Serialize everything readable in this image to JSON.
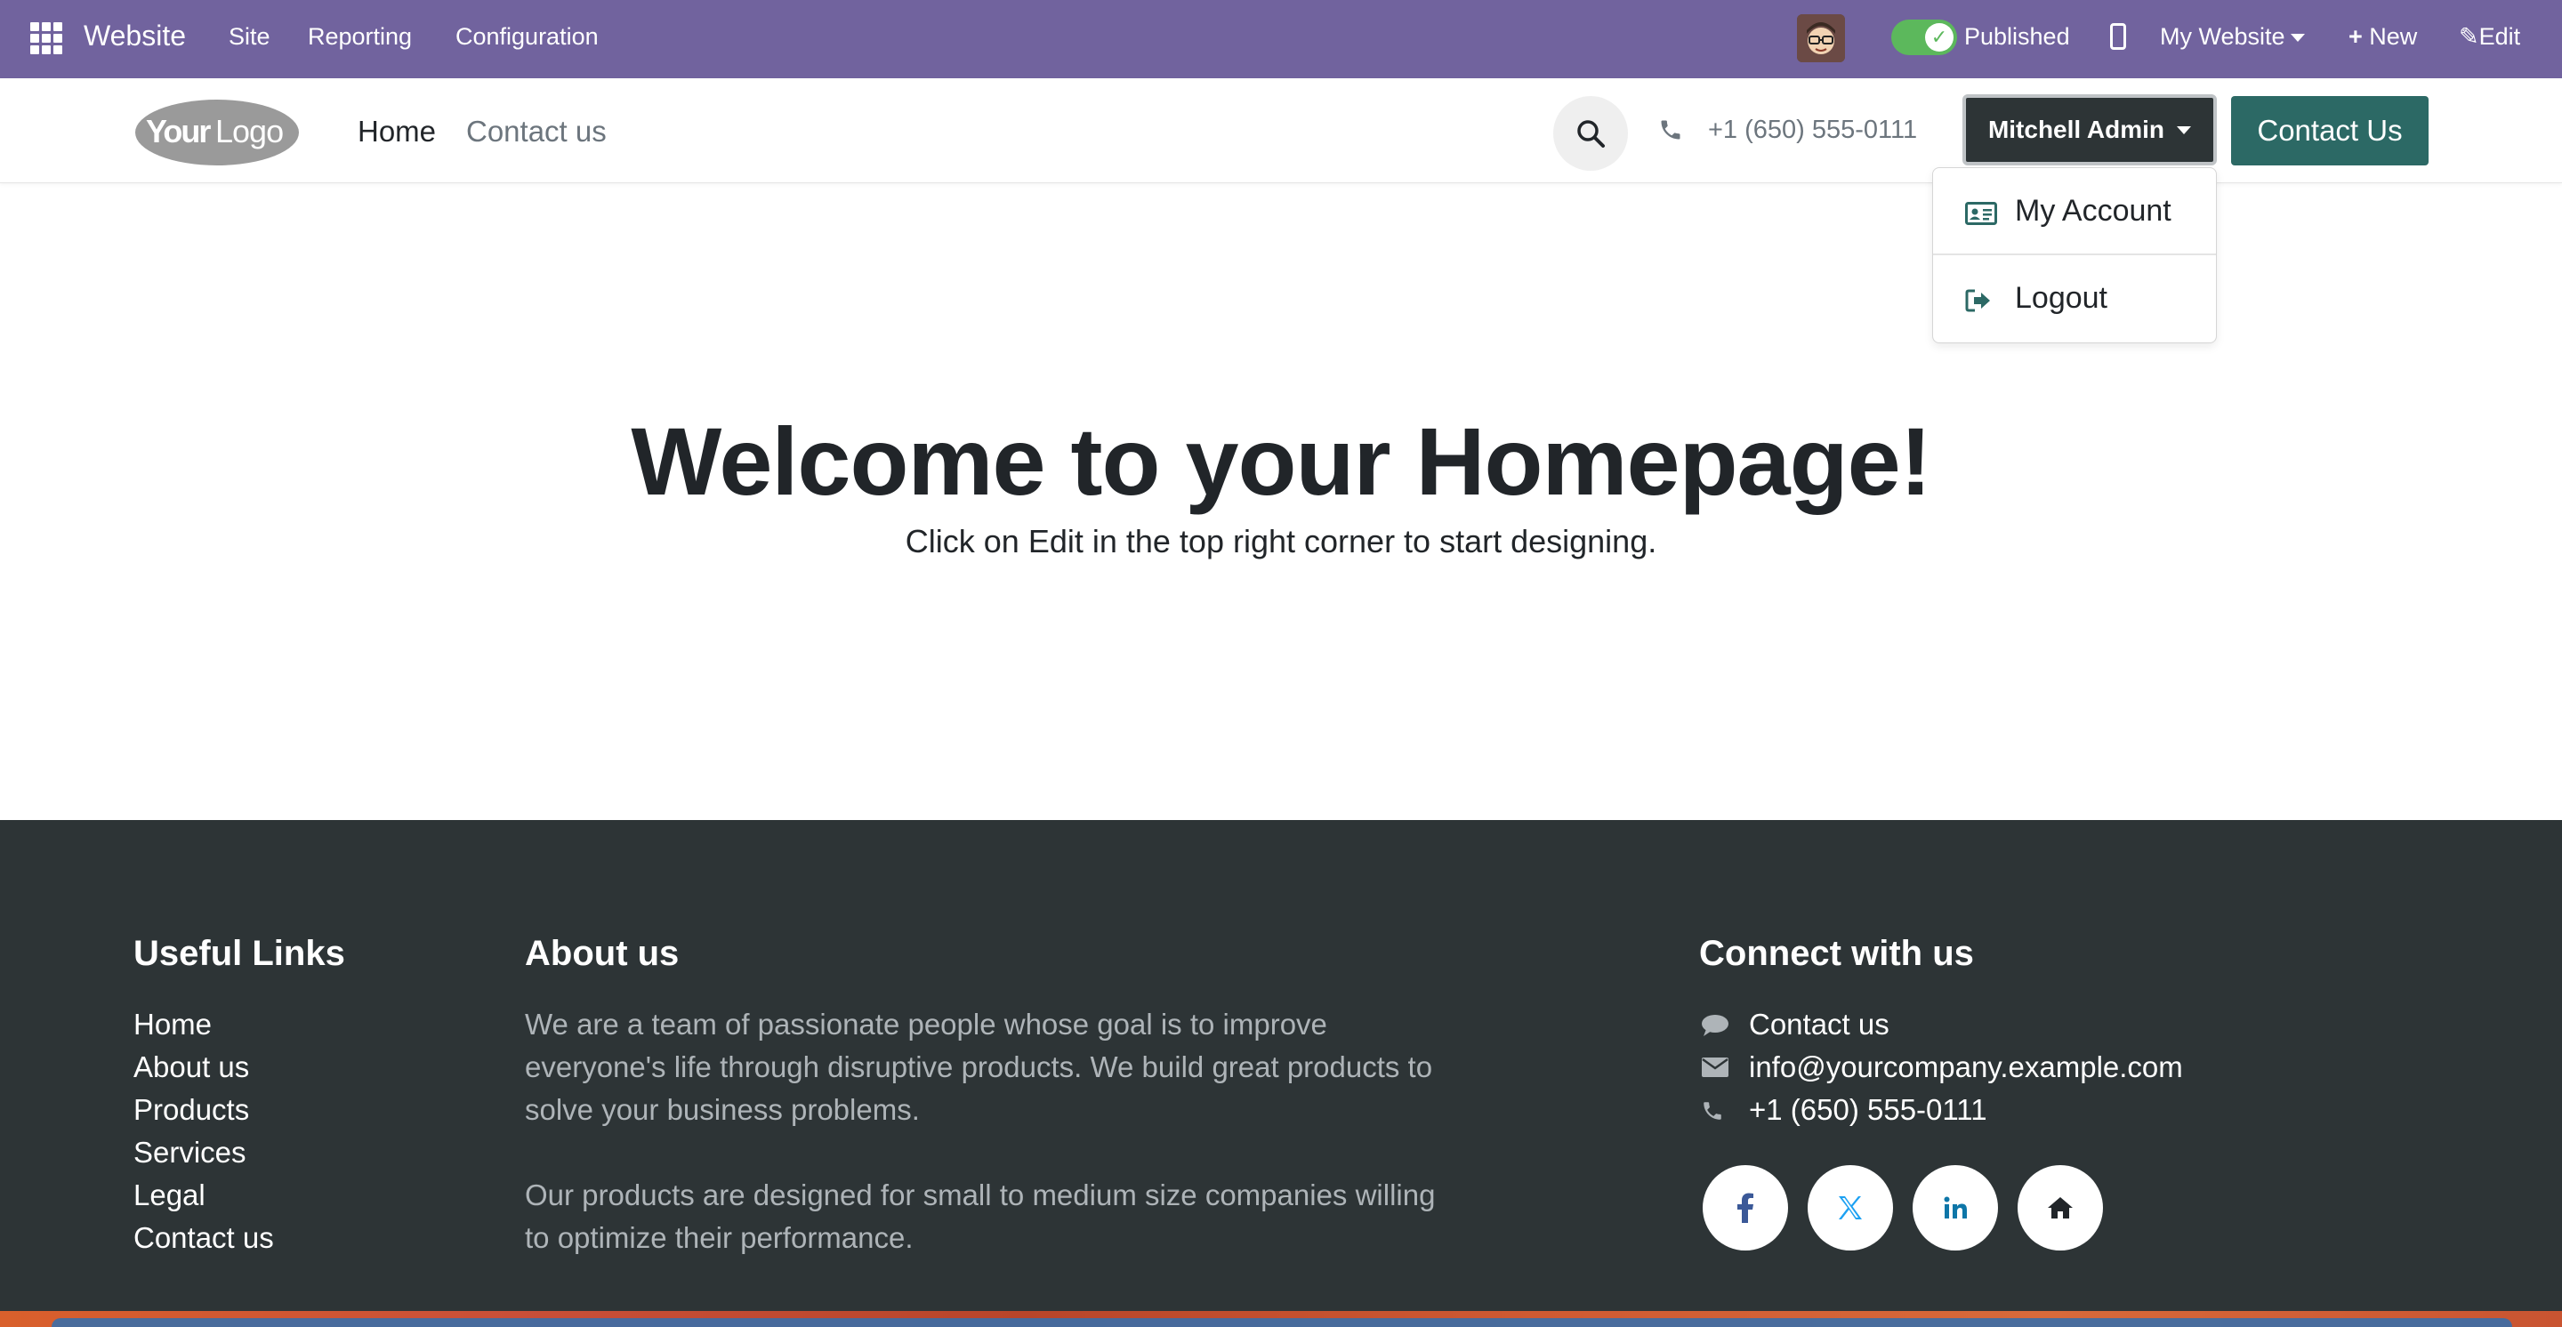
{
  "admin_bar": {
    "brand": "Website",
    "menus": [
      "Site",
      "Reporting",
      "Configuration"
    ],
    "published_label": "Published",
    "my_website": "My Website",
    "new_label": "New",
    "edit_label": "Edit",
    "color": "#71639e",
    "toggle_color": "#5cb85c"
  },
  "header": {
    "logo_text": "YourLogo",
    "nav": [
      "Home",
      "Contact us"
    ],
    "phone": "+1 (650) 555-0111",
    "user_name": "Mitchell Admin",
    "contact_button": "Contact Us",
    "accent": "#2c6965"
  },
  "dropdown": {
    "items": [
      {
        "label": "My Account",
        "icon": "id-card-icon"
      },
      {
        "label": "Logout",
        "icon": "sign-out-icon"
      }
    ]
  },
  "hero": {
    "title": "Welcome to your Homepage!",
    "subtitle_before": "Click on ",
    "subtitle_edit": "Edit",
    "subtitle_after": " in the top right corner to start designing."
  },
  "footer": {
    "useful_links_title": "Useful Links",
    "links": [
      "Home",
      "About us",
      "Products",
      "Services",
      "Legal",
      "Contact us"
    ],
    "about_title": "About us",
    "about_p1": "We are a team of passionate people whose goal is to improve everyone's life through disruptive products. We build great products to solve your business problems.",
    "about_p2": "Our products are designed for small to medium size companies willing to optimize their performance.",
    "connect_title": "Connect with us",
    "connect": [
      {
        "icon": "comment-icon",
        "text": "Contact us"
      },
      {
        "icon": "envelope-icon",
        "text": "info@yourcompany.example.com"
      },
      {
        "icon": "phone-icon",
        "text": "+1 (650) 555-0111"
      }
    ],
    "socials": [
      "facebook-icon",
      "x-twitter-icon",
      "linkedin-icon",
      "home-icon"
    ],
    "background": "#2d3436"
  }
}
